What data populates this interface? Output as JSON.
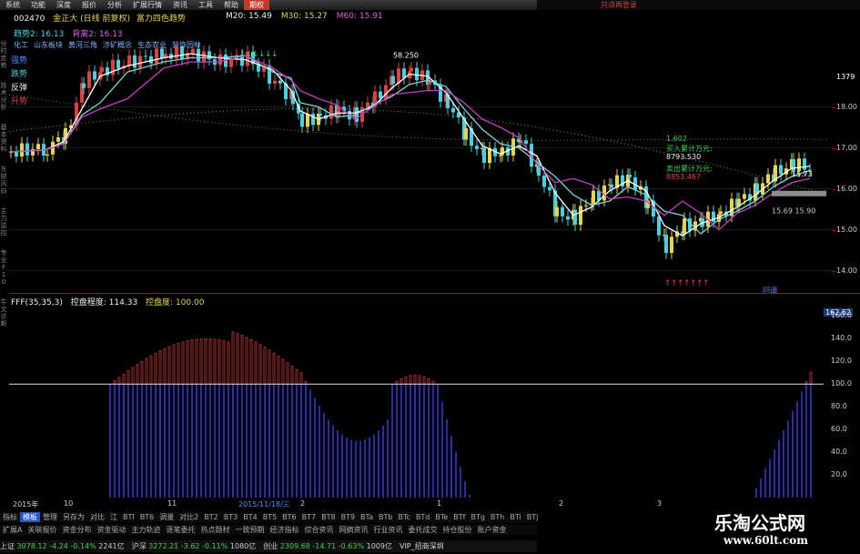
{
  "menubar": {
    "items": [
      "系统",
      "功能",
      "深度",
      "报价",
      "分析",
      "扩展行情",
      "资讯",
      "工具",
      "帮助",
      "期权"
    ],
    "active_index": 9,
    "right_text": "只须再登录"
  },
  "header": {
    "code": "002470",
    "name": "金正大",
    "period": "(日线 前复权)",
    "indicator": "富力四色趋势",
    "ma": [
      {
        "label": "M20: 15.49",
        "color": "#eeeeee"
      },
      {
        "label": "M30: 15.27",
        "color": "#e8d44a"
      },
      {
        "label": "M60: 15.91",
        "color": "#e060e0"
      }
    ]
  },
  "trend": {
    "label1": "趋势2: 16.13",
    "label2": "背离2: 16.13"
  },
  "concepts": [
    "化工",
    "山东板块",
    "黄河三角",
    "涉矿概念",
    "生态农业",
    "装饰园林"
  ],
  "legend": [
    {
      "label": "强势",
      "color": "#5b8cff"
    },
    {
      "label": "跌势",
      "color": "#46d0e0"
    },
    {
      "label": "反弹",
      "color": "#eeeeee"
    },
    {
      "label": "升势",
      "color": "#e04040"
    }
  ],
  "left_nav": [
    "分时走势",
    "技术分析",
    "基本资料",
    "东财风向",
    "主力监控",
    "专业F10",
    "牛叉诊断"
  ],
  "price_chart": {
    "yticks": [
      14.0,
      15.0,
      16.0,
      17.0,
      18.0
    ],
    "high_label": "58.250",
    "current_price_label": "1379",
    "mid_label": "15.73",
    "mid_label2": "15.69  15.90",
    "ylim": [
      13.5,
      19.5
    ]
  },
  "annotations": {
    "a1": "1.602",
    "a2": "买入累计万元:",
    "a3": "8793.530",
    "a4": "卖出累计万元:",
    "a5": "8853.467",
    "marker": "回调"
  },
  "sub_header": {
    "title": "FFF(35,35,3)",
    "label1": "控盘程度: 114.33",
    "label2": "控盘度: 100.00"
  },
  "sub_chart": {
    "yticks": [
      20.0,
      40.0,
      60.0,
      80.0,
      100.0,
      120.0,
      140.0,
      160.0
    ],
    "current_value": "162.62",
    "ylim": [
      0,
      170
    ],
    "baseline": 100
  },
  "x_axis": {
    "labels": [
      "2015年",
      "10",
      "11",
      "2015/11/18/三",
      "2",
      "1",
      "2",
      "3"
    ]
  },
  "toolbar1": [
    "指标",
    "模板",
    "管理",
    "另存为",
    "对比",
    "江",
    "BTI",
    "BT6",
    "调量",
    "对比2",
    "BT2",
    "BT3",
    "BT4",
    "BT5",
    "BT6",
    "BT7",
    "BT8",
    "BT9",
    "BTa",
    "BTb",
    "BTc",
    "BTd",
    "BTe",
    "BTf",
    "BTg",
    "BTh",
    "BTi",
    "BTj"
  ],
  "toolbar2": [
    "扩展A",
    "关联报价",
    "资金分布",
    "资金驱动",
    "主力轨迹",
    "逐笔委托",
    "热点题材",
    "一致预期",
    "经济指标",
    "综合资讯",
    "网摘资讯",
    "行业资讯",
    "委托成交",
    "持仓股份",
    "账户资金"
  ],
  "statusbar": {
    "items": [
      {
        "label": "上证",
        "value": "3078.12",
        "change": "-4.24",
        "pct": "-0.14%",
        "vol": "2241亿"
      },
      {
        "label": "沪深",
        "value": "3272.21",
        "change": "-3.62",
        "pct": "-0.11%",
        "vol": "1080亿"
      },
      {
        "label": "创业",
        "value": "2309.68",
        "change": "-14.71",
        "pct": "-0.63%",
        "vol": "1009亿"
      }
    ],
    "extra": "VIP_招商深圳"
  },
  "watermark": {
    "title": "乐淘公式网",
    "url": "www.60lt.com"
  },
  "colors": {
    "up": "#e04040",
    "down": "#46d0e0",
    "neutral": "#e8d44a",
    "ma_white": "#ffffff",
    "ma_cyan": "#7ed4d4",
    "ma_magenta": "#c040c0",
    "sub_up": "#a03030",
    "sub_down": "#2a2ca0"
  }
}
